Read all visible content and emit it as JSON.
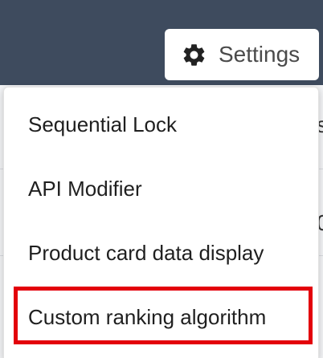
{
  "header": {
    "settings_button": {
      "icon": "gear-icon",
      "label": "Settings"
    }
  },
  "settings_menu": {
    "items": [
      {
        "label": "Sequential Lock"
      },
      {
        "label": "API Modifier"
      },
      {
        "label": "Product card data display"
      },
      {
        "label": "Custom ranking algorithm",
        "highlighted": true
      }
    ],
    "highlight_color": "#e3000b"
  },
  "colors": {
    "topbar": "#3e4b5e",
    "menu_background": "#ffffff",
    "text": "#1f1f1f"
  }
}
